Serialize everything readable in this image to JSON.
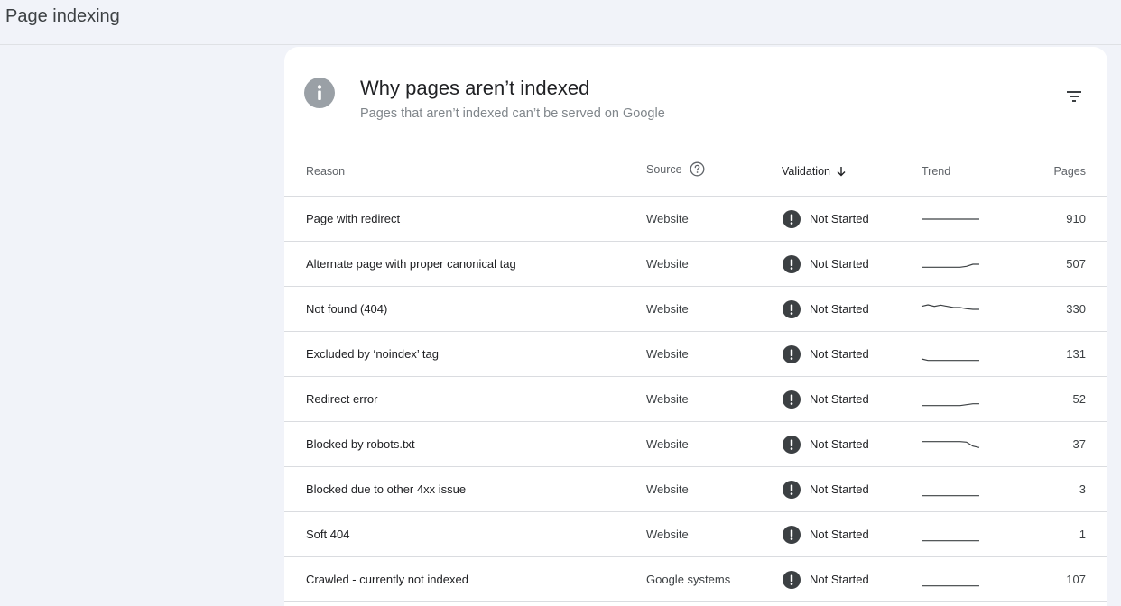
{
  "page": {
    "title": "Page indexing"
  },
  "card": {
    "title": "Why pages aren’t indexed",
    "subtitle": "Pages that aren’t indexed can’t be served on Google"
  },
  "table": {
    "headers": {
      "reason": "Reason",
      "source": "Source",
      "validation": "Validation",
      "trend": "Trend",
      "pages": "Pages"
    },
    "rows": [
      {
        "reason": "Page with redirect",
        "source": "Website",
        "validation": "Not Started",
        "pages": "910",
        "trend": [
          3,
          3,
          3,
          3,
          3,
          3,
          3,
          3,
          3,
          3
        ]
      },
      {
        "reason": "Alternate page with proper canonical tag",
        "source": "Website",
        "validation": "Not Started",
        "pages": "507",
        "trend": [
          2,
          2,
          2,
          2,
          2,
          2,
          2,
          2.3,
          3,
          3
        ]
      },
      {
        "reason": "Not found (404)",
        "source": "Website",
        "validation": "Not Started",
        "pages": "330",
        "trend": [
          4,
          4.5,
          4,
          4.4,
          4,
          3.6,
          3.6,
          3.2,
          3,
          3
        ]
      },
      {
        "reason": "Excluded by ‘noindex’ tag",
        "source": "Website",
        "validation": "Not Started",
        "pages": "131",
        "trend": [
          1.5,
          1,
          1,
          1,
          1,
          1,
          1,
          1,
          1,
          1
        ]
      },
      {
        "reason": "Redirect error",
        "source": "Website",
        "validation": "Not Started",
        "pages": "52",
        "trend": [
          1,
          1,
          1,
          1,
          1,
          1,
          1,
          1.3,
          1.6,
          1.6
        ]
      },
      {
        "reason": "Blocked by robots.txt",
        "source": "Website",
        "validation": "Not Started",
        "pages": "37",
        "trend": [
          4,
          4,
          4,
          4,
          4,
          4,
          4,
          3.8,
          2.5,
          2
        ]
      },
      {
        "reason": "Blocked due to other 4xx issue",
        "source": "Website",
        "validation": "Not Started",
        "pages": "3",
        "trend": [
          1,
          1,
          1,
          1,
          1,
          1,
          1,
          1,
          1,
          1
        ]
      },
      {
        "reason": "Soft 404",
        "source": "Website",
        "validation": "Not Started",
        "pages": "1",
        "trend": [
          1,
          1,
          1,
          1,
          1,
          1,
          1,
          1,
          1,
          1
        ]
      },
      {
        "reason": "Crawled - currently not indexed",
        "source": "Google systems",
        "validation": "Not Started",
        "pages": "107",
        "trend": [
          1,
          1,
          1,
          1,
          1,
          1,
          1,
          1,
          1,
          1
        ]
      }
    ]
  },
  "icons": {
    "info": "info-icon",
    "filter": "filter-icon",
    "help": "help-icon",
    "sort": "arrow-down-icon",
    "status": "exclamation-icon"
  },
  "colors": {
    "background": "#f1f3f9",
    "card": "#ffffff",
    "status_icon": "#3c4043",
    "info_icon": "#9aa0a6",
    "trend_line": "#3c4043"
  }
}
